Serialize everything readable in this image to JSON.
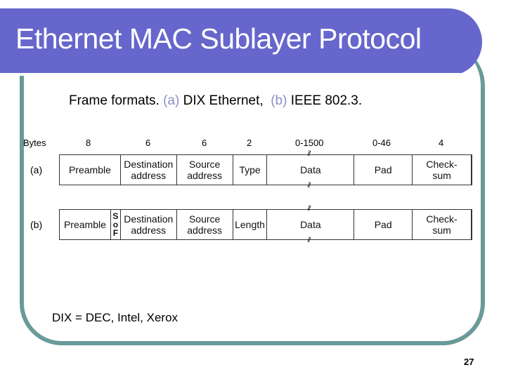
{
  "slide": {
    "title": "Ethernet MAC Sublayer Protocol",
    "caption": {
      "prefix": "Frame formats.",
      "label_a": "(a)",
      "text_a": "DIX Ethernet,",
      "label_b": "(b)",
      "text_b": "IEEE 802.3."
    },
    "colors": {
      "banner": "#6666cc",
      "frame": "#6a9a9a",
      "caption_label": "#8c8cc6"
    },
    "diagram": {
      "bytes_label": "Bytes",
      "byte_counts": [
        "8",
        "6",
        "6",
        "2",
        "0-1500",
        "0-46",
        "4"
      ],
      "break_mark": "≀≀",
      "frame_a": {
        "label": "(a)",
        "fields": [
          "Preamble",
          "Destination address",
          "Source address",
          "Type",
          "Data",
          "Pad",
          "Check-sum"
        ]
      },
      "frame_b": {
        "label": "(b)",
        "fields": [
          "Preamble",
          "S o F",
          "Destination address",
          "Source address",
          "Length",
          "Data",
          "Pad",
          "Check-sum"
        ],
        "sof_letters": [
          "S",
          "o",
          "F"
        ]
      }
    },
    "footnote": "DIX = DEC, Intel, Xerox",
    "page_number": "27"
  }
}
